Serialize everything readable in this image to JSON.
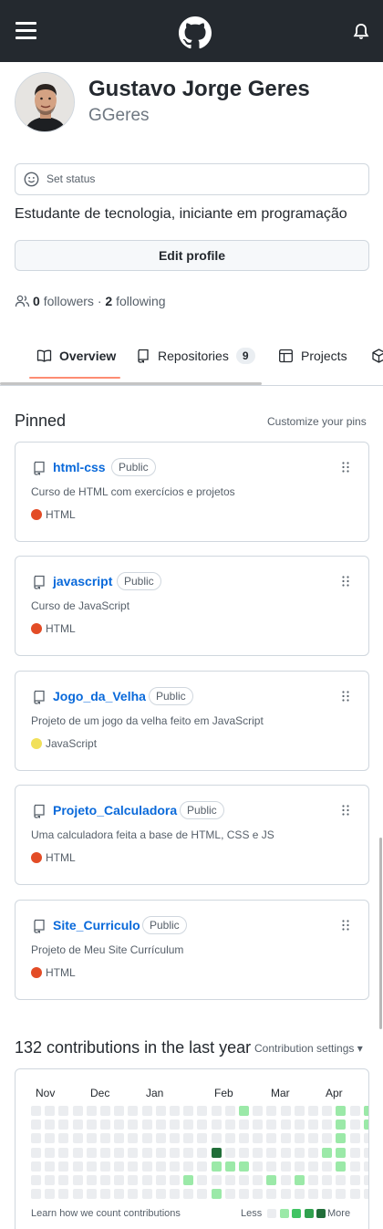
{
  "header": {
    "logo_icon": "github-mark-icon",
    "menu_icon": "hamburger-icon",
    "notifications_icon": "bell-icon"
  },
  "profile": {
    "full_name": "Gustavo Jorge Geres",
    "username": "GGeres",
    "status_placeholder": "Set status",
    "bio": "Estudante de tecnologia, iniciante em programação",
    "edit_profile_label": "Edit profile",
    "followers_count": "0",
    "followers_label": "followers",
    "separator": "·",
    "following_count": "2",
    "following_label": "following"
  },
  "tabs": [
    {
      "label": "Overview",
      "icon": "book-icon",
      "active": true
    },
    {
      "label": "Repositories",
      "icon": "repo-icon",
      "count": "9"
    },
    {
      "label": "Projects",
      "icon": "table-icon"
    },
    {
      "label": "",
      "icon": "package-icon"
    }
  ],
  "pinned": {
    "title": "Pinned",
    "customize_label": "Customize your pins",
    "repos": [
      {
        "name": "html-css",
        "visibility": "Public",
        "description": "Curso de HTML com exercícios e projetos",
        "language": "HTML",
        "language_color": "#e34c26"
      },
      {
        "name": "javascript",
        "visibility": "Public",
        "description": "Curso de JavaScript",
        "language": "HTML",
        "language_color": "#e34c26"
      },
      {
        "name": "Jogo_da_Velha",
        "visibility": "Public",
        "description": "Projeto de um jogo da velha feito em JavaScript",
        "language": "JavaScript",
        "language_color": "#f1e05a"
      },
      {
        "name": "Projeto_Calculadora",
        "visibility": "Public",
        "description": "Uma calculadora feita a base de HTML, CSS e JS",
        "language": "HTML",
        "language_color": "#e34c26"
      },
      {
        "name": "Site_Curriculo",
        "visibility": "Public",
        "description": "Projeto de Meu Site Currículum",
        "language": "HTML",
        "language_color": "#e34c26"
      }
    ]
  },
  "contributions": {
    "title": "132 contributions in the last year",
    "settings_label": "Contribution settings",
    "months": [
      "Nov",
      "Dec",
      "Jan",
      "Feb",
      "Mar",
      "Apr"
    ],
    "learn_label": "Learn how we count contributions",
    "less_label": "Less",
    "more_label": "More",
    "level_colors": [
      "#ebedf0",
      "#9be9a8",
      "#40c463",
      "#30a14e",
      "#216e39"
    ],
    "weeks": [
      [
        0,
        0,
        0,
        0,
        0,
        0,
        0
      ],
      [
        0,
        0,
        0,
        0,
        0,
        0,
        0
      ],
      [
        0,
        0,
        0,
        0,
        0,
        0,
        0
      ],
      [
        0,
        0,
        0,
        0,
        0,
        0,
        0
      ],
      [
        0,
        0,
        0,
        0,
        0,
        0,
        0
      ],
      [
        0,
        0,
        0,
        0,
        0,
        0,
        0
      ],
      [
        0,
        0,
        0,
        0,
        0,
        0,
        0
      ],
      [
        0,
        0,
        0,
        0,
        0,
        0,
        0
      ],
      [
        0,
        0,
        0,
        0,
        0,
        0,
        0
      ],
      [
        0,
        0,
        0,
        0,
        0,
        0,
        0
      ],
      [
        0,
        0,
        0,
        0,
        0,
        0,
        0
      ],
      [
        0,
        0,
        0,
        0,
        0,
        1,
        0
      ],
      [
        0,
        0,
        0,
        0,
        0,
        0,
        0
      ],
      [
        0,
        0,
        0,
        4,
        1,
        0,
        1
      ],
      [
        0,
        0,
        0,
        0,
        1,
        0,
        0
      ],
      [
        1,
        0,
        0,
        0,
        1,
        0,
        0
      ],
      [
        0,
        0,
        0,
        0,
        0,
        0,
        0
      ],
      [
        0,
        0,
        0,
        0,
        0,
        1,
        0
      ],
      [
        0,
        0,
        0,
        0,
        0,
        0,
        0
      ],
      [
        0,
        0,
        0,
        0,
        0,
        1,
        0
      ],
      [
        0,
        0,
        0,
        0,
        0,
        0,
        0
      ],
      [
        0,
        0,
        0,
        1,
        0,
        0,
        0
      ],
      [
        1,
        1,
        1,
        1,
        1,
        0,
        0
      ],
      [
        0,
        0,
        0,
        0,
        0,
        0,
        0
      ],
      [
        1,
        1,
        0,
        0,
        0,
        0,
        0
      ],
      [
        4,
        1,
        1,
        1,
        0,
        4,
        0
      ],
      [
        4,
        0,
        0,
        4,
        0,
        0,
        0
      ],
      [
        1,
        0,
        0,
        0,
        0,
        0,
        0
      ]
    ]
  }
}
